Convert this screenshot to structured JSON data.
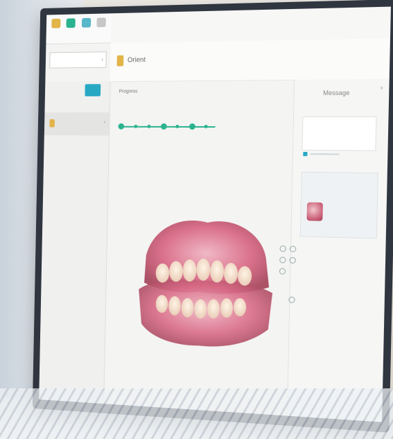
{
  "window": {
    "tab_text": "",
    "user_text": ""
  },
  "toolbar": {
    "tools": [
      {
        "icon": "pin-icon",
        "label": "",
        "color": "#e2b449"
      },
      {
        "icon": "scan-icon",
        "label": "",
        "color": "#2ab38e"
      },
      {
        "icon": "tooth-icon",
        "label": "",
        "color": "#58b7c9"
      },
      {
        "icon": "grid-icon",
        "label": "",
        "color": "#c7c7c7"
      }
    ]
  },
  "sidebar": {
    "label": "",
    "new_button": "",
    "item": {
      "title": "",
      "subtitle": ""
    }
  },
  "header": {
    "title": "Orient"
  },
  "progress": {
    "title": "Progress",
    "subtitle": "",
    "steps": [
      "",
      "",
      ""
    ],
    "accent": "#2ab38e"
  },
  "details": {
    "title": "",
    "rows": [
      "",
      "",
      "",
      "",
      "",
      "",
      ""
    ]
  },
  "messages": {
    "title": "Message",
    "placeholder": "",
    "card_title": "",
    "card_subtitle": ""
  },
  "brand": {
    "text": ""
  },
  "colors": {
    "accent": "#29a8c4",
    "progress": "#2ab38e",
    "gum": "#d96a86"
  }
}
